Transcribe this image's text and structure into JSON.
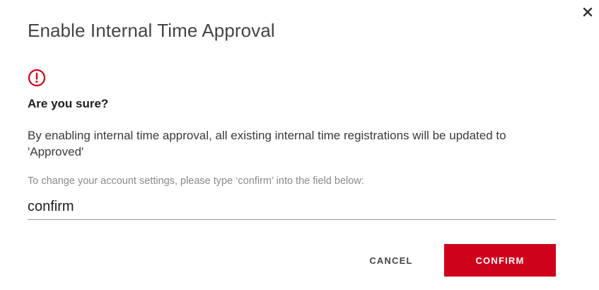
{
  "dialog": {
    "title": "Enable Internal Time Approval",
    "question": "Are you sure?",
    "description": "By enabling internal time approval, all existing internal time registrations will be updated to 'Approved'",
    "instruction": "To change your account settings, please type ‘confirm’ into the field below:",
    "input_value": "confirm",
    "cancel_label": "CANCEL",
    "confirm_label": "CONFIRM",
    "icons": {
      "close": "close-icon",
      "warning": "warning-circle-icon"
    },
    "colors": {
      "accent": "#d0021b",
      "title": "#444444",
      "body": "#3a3a3a",
      "muted": "#8a8a8a"
    }
  }
}
